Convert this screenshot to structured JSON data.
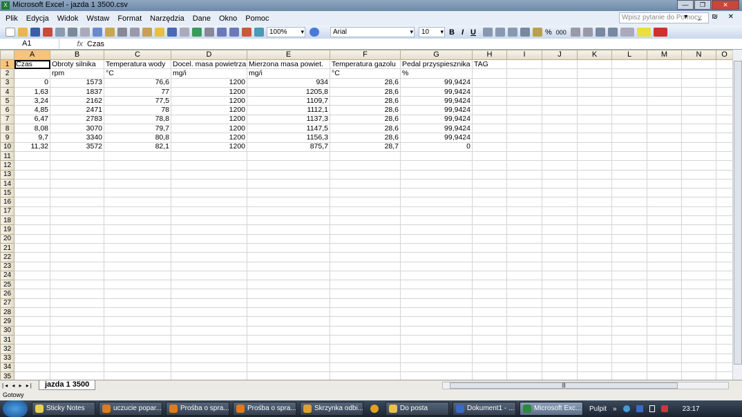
{
  "window": {
    "title": "Microsoft Excel - jazda 1 3500.csv",
    "app_icon": "X",
    "controls": [
      "—",
      "❐",
      "✕"
    ]
  },
  "menu": {
    "items": [
      "Plik",
      "Edycja",
      "Widok",
      "Wstaw",
      "Format",
      "Narzędzia",
      "Dane",
      "Okno",
      "Pomoc"
    ],
    "help_placeholder": "Wpisz pytanie do Pomocy",
    "doc_controls": "▾ _ ₪ ✕"
  },
  "toolbar": {
    "zoom": "100%",
    "font": "Arial",
    "size": "10",
    "bold": "B",
    "italic": "I",
    "underline": "U",
    "percent": "%",
    "thousands": "000"
  },
  "formula_bar": {
    "cell_ref": "A1",
    "fx": "fx",
    "content": "Czas"
  },
  "columns": [
    "A",
    "B",
    "C",
    "D",
    "E",
    "F",
    "G",
    "H",
    "I",
    "J",
    "K",
    "L",
    "M",
    "N",
    "O"
  ],
  "rows": [
    [
      "Czas",
      "Obroty silnika",
      "Temperatura wody",
      "Docel. masa powietrza",
      "Mierzona masa powiet.",
      "Temperatura gazolu",
      "Pedal przyspiesznika",
      "TAG"
    ],
    [
      "",
      "rpm",
      "°C",
      "mg/i",
      "mg/i",
      "°C",
      "%",
      ""
    ],
    [
      "0",
      "1573",
      "76,6",
      "1200",
      "934",
      "28,6",
      "99,9424"
    ],
    [
      "1,63",
      "1837",
      "77",
      "1200",
      "1205,8",
      "28,6",
      "99,9424"
    ],
    [
      "3,24",
      "2162",
      "77,5",
      "1200",
      "1109,7",
      "28,6",
      "99,9424"
    ],
    [
      "4,85",
      "2471",
      "78",
      "1200",
      "1112,1",
      "28,6",
      "99,9424"
    ],
    [
      "6,47",
      "2783",
      "78,8",
      "1200",
      "1137,3",
      "28,6",
      "99,9424"
    ],
    [
      "8,08",
      "3070",
      "79,7",
      "1200",
      "1147,5",
      "28,6",
      "99,9424"
    ],
    [
      "9,7",
      "3340",
      "80,8",
      "1200",
      "1156,3",
      "28,6",
      "99,9424"
    ],
    [
      "11,32",
      "3572",
      "82,1",
      "1200",
      "875,7",
      "28,7",
      "0"
    ]
  ],
  "row_count": 35,
  "sheet": {
    "nav": "|◂ ◂ ▸ ▸|",
    "tab": "jazda 1 3500",
    "scroll_grip": "|||"
  },
  "status": {
    "text": "Gotowy"
  },
  "taskbar": {
    "items": [
      {
        "label": "Sticky Notes",
        "color": "#e8d24a"
      },
      {
        "label": "uczucie popar...",
        "color": "#e07a1a"
      },
      {
        "label": "Prośba o spra...",
        "color": "#e07a1a"
      },
      {
        "label": "Prośba o spra...",
        "color": "#e07a1a"
      },
      {
        "label": "Skrzynka odbi...",
        "color": "#e0a030"
      },
      {
        "label": "Do posta",
        "color": "#e8c050"
      },
      {
        "label": "Dokument1 - ...",
        "color": "#3a6ac8"
      },
      {
        "label": "Microsoft Exc...",
        "color": "#2a8a3a"
      }
    ],
    "desktop": "Pulpit",
    "chevron": "»",
    "time": "23:17"
  }
}
